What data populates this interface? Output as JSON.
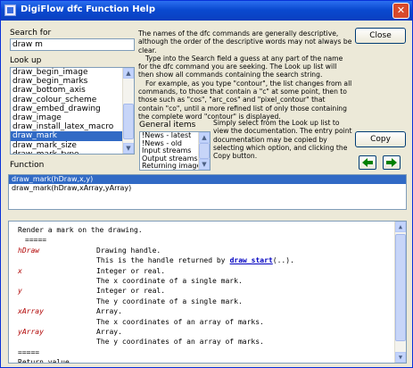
{
  "window": {
    "title": "DigiFlow dfc Function Help"
  },
  "search": {
    "label": "Search for",
    "value": "draw m"
  },
  "lookup": {
    "label": "Look up",
    "items": [
      {
        "label": "draw_begin_image",
        "selected": false
      },
      {
        "label": "draw_begin_marks",
        "selected": false
      },
      {
        "label": "draw_bottom_axis",
        "selected": false
      },
      {
        "label": "draw_colour_scheme",
        "selected": false
      },
      {
        "label": "draw_embed_drawing",
        "selected": false
      },
      {
        "label": "draw_image",
        "selected": false
      },
      {
        "label": "draw_install_latex_macro",
        "selected": false
      },
      {
        "label": "draw_mark",
        "selected": true
      },
      {
        "label": "draw_mark_size",
        "selected": false
      },
      {
        "label": "draw_mark_type",
        "selected": false
      }
    ]
  },
  "description": {
    "p1": "The names of the dfc commands are generally descriptive, although the order of the descriptive words may not always be clear.",
    "p2": "Type into the Search field a guess at any part of the name for the dfc command you are seeking. The Look up list will then show all commands containing the search string.",
    "p3": "For example, as you type \"contour\", the list changes from all commands, to those that contain a \"c\" at some point, then to those such as \"cos\", \"arc_cos\" and \"pixel_contour\" that contain \"co\", until a more refined list of only those containing the complete word \"contour\" is displayed.",
    "p4": "Simply select from the Look up list to view the documentation. The entry point documentation may be copied by selecting which option, and clicking the Copy button."
  },
  "general": {
    "label": "General items",
    "items": [
      "!News - latest",
      "!News - old",
      "Input streams",
      "Output streams",
      "Returning images"
    ]
  },
  "buttons": {
    "close": "Close",
    "copy": "Copy"
  },
  "icons": {
    "back": "arrow-left-icon",
    "forward": "arrow-right-icon",
    "arrow_color": "#008000"
  },
  "function": {
    "label": "Function",
    "items": [
      {
        "label": "draw_mark(hDraw,x,y)",
        "selected": true
      },
      {
        "label": "draw_mark(hDraw,xArray,yArray)",
        "selected": false
      }
    ]
  },
  "doc": {
    "summary": "Render a mark on the drawing.",
    "sep": "=====",
    "params": [
      {
        "name": "hDraw",
        "lines": [
          "Drawing handle.",
          "This is the handle returned by"
        ],
        "link": "draw_start",
        "link_suffix": "(..)."
      },
      {
        "name": "x",
        "lines": [
          "Integer or real.",
          "The x coordinate of a single mark."
        ]
      },
      {
        "name": "y",
        "lines": [
          "Integer or real.",
          "The y coordinate of a single mark."
        ]
      },
      {
        "name": "xArray",
        "lines": [
          "Array.",
          "The x coordinates of an array of marks."
        ]
      },
      {
        "name": "yArray",
        "lines": [
          "Array.",
          "The y coordinates of an array of marks."
        ]
      }
    ],
    "sep2": "=====",
    "partial": "Return value"
  }
}
